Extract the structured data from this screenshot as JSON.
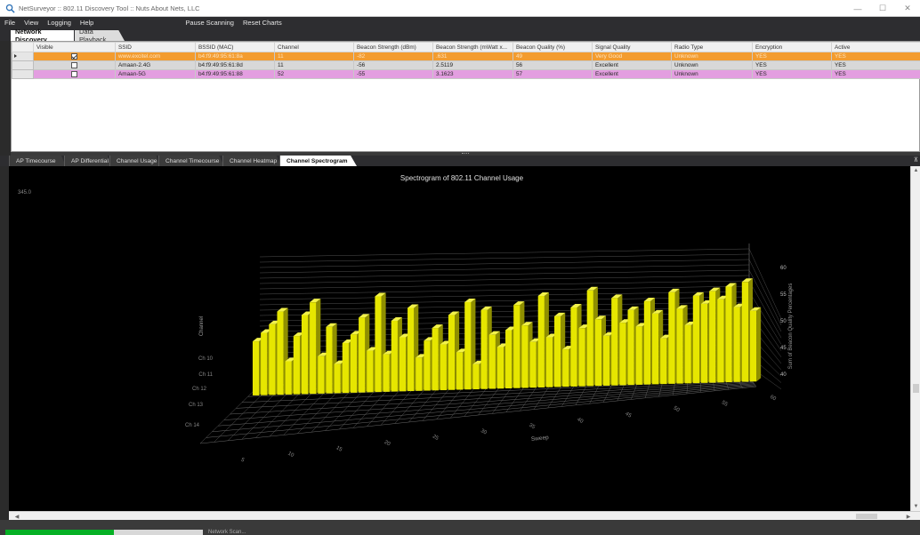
{
  "window": {
    "title": "NetSurveyor :: 802.11 Discovery Tool :: Nuts About Nets, LLC",
    "controls": [
      "—",
      "☐",
      "✕"
    ]
  },
  "menu": {
    "items": [
      "File",
      "View",
      "Logging",
      "Help"
    ],
    "actions": [
      "Pause Scanning",
      "Reset Charts"
    ]
  },
  "top_tabs": [
    {
      "label": "Network Discovery",
      "active": true
    },
    {
      "label": "Data Playback",
      "active": false
    }
  ],
  "grid": {
    "columns": [
      "Visible",
      "SSID",
      "BSSID (MAC)",
      "Channel",
      "Beacon Strength (dBm)",
      "Beacon Strength (mWatt x...",
      "Beacon Quality (%)",
      "Signal Quality",
      "Radio Type",
      "Encryption",
      "Active"
    ],
    "rows": [
      {
        "visible": true,
        "ssid": "www.excitel.com",
        "bssid": "b4:f9:49:95:61:8a",
        "channel": "11",
        "dbm": "-82",
        "mwatt": ".631",
        "quality": "49",
        "signal": "Very Good",
        "radio": "Unknown",
        "encryption": "YES",
        "active": "YES",
        "color": "#f39c2f"
      },
      {
        "visible": false,
        "ssid": "Amaan-2.4G",
        "bssid": "b4:f9:49:95:61:8d",
        "channel": "11",
        "dbm": "-56",
        "mwatt": "2.5119",
        "quality": "56",
        "signal": "Excellent",
        "radio": "Unknown",
        "encryption": "YES",
        "active": "YES",
        "color": "#d8d8d8"
      },
      {
        "visible": false,
        "ssid": "Amaan-5G",
        "bssid": "b4:f9:49:95:61:88",
        "channel": "52",
        "dbm": "-55",
        "mwatt": "3.1623",
        "quality": "57",
        "signal": "Excellent",
        "radio": "Unknown",
        "encryption": "YES",
        "active": "YES",
        "color": "#e39ee0"
      }
    ]
  },
  "bottom_tabs": [
    {
      "label": "AP Timecourse",
      "active": false
    },
    {
      "label": "AP Differential",
      "active": false
    },
    {
      "label": "Channel Usage",
      "active": false
    },
    {
      "label": "Channel Timecourse",
      "active": false
    },
    {
      "label": "Channel Heatmap",
      "active": false
    },
    {
      "label": "Channel Spectrogram",
      "active": true
    }
  ],
  "chart_panel": {
    "corner_label": "345.0"
  },
  "chart_data": {
    "type": "bar",
    "title": "Spectrogram of 802.11 Channel Usage",
    "xlabel": "Sweep",
    "ylabel": "Sum of Beacon Quality Percentages",
    "zlabel": "Channel",
    "x_ticks": [
      "5",
      "10",
      "15",
      "20",
      "25",
      "30",
      "35",
      "40",
      "45",
      "50",
      "55",
      "60"
    ],
    "y_ticks": [
      "40",
      "45",
      "50",
      "55",
      "60"
    ],
    "channel_ticks": [
      "Ch 10",
      "Ch 11",
      "Ch 12",
      "Ch 13",
      "Ch 14"
    ],
    "ylim": [
      38,
      63
    ],
    "series": [
      {
        "channel": "Ch 11",
        "color": "#e6e600",
        "values": [
          51,
          53,
          55,
          58,
          46,
          52,
          57,
          60,
          47,
          54,
          45,
          50,
          52,
          56,
          48,
          61,
          47,
          55,
          51,
          58,
          46,
          50,
          53,
          49,
          56,
          47,
          59,
          44,
          57,
          51,
          48,
          52,
          58,
          53,
          49,
          60,
          50,
          55,
          47,
          57,
          52,
          61,
          54,
          50,
          59,
          53,
          56,
          52,
          58,
          55,
          49,
          60,
          56,
          52,
          59,
          57,
          60,
          58,
          61,
          56,
          62,
          55
        ]
      }
    ]
  },
  "status": {
    "progress": 0.55,
    "text": "Network Scan..."
  }
}
